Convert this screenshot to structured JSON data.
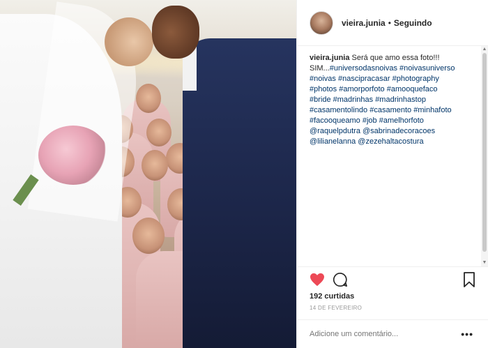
{
  "post": {
    "username": "vieira.junia",
    "separator": "•",
    "follow_status": "Seguindo",
    "caption": {
      "user": "vieira.junia",
      "lines": [
        "Será que amo essa foto!!!",
        "SIM...",
        "#universodasnoivas",
        "#noivasuniverso",
        "#noivas",
        "#nascipracasar",
        "#photography",
        "#photos",
        "#amorporfoto",
        "#amooquefaco",
        "#bride",
        "#madrinhas",
        "#madrinhastop",
        "#casamentolindo",
        "#casamento",
        "#minhafoto",
        "#facooqueamo",
        "#job",
        "#amelhorfoto",
        "@raquelpdutra",
        "@sabrinadecoracoes",
        "@lilianelanna",
        "@zezehaltacostura"
      ]
    },
    "likes": "192 curtidas",
    "date": "14 DE FEVEREIRO",
    "comment_placeholder": "Adicione um comentário...",
    "more_label": "•••"
  },
  "icons": {
    "like": "heart-icon",
    "comment": "comment-icon",
    "save": "bookmark-icon",
    "more": "more-options-icon"
  },
  "colors": {
    "heart": "#ed4956",
    "link": "#003569",
    "text": "#262626",
    "muted": "#999999"
  }
}
